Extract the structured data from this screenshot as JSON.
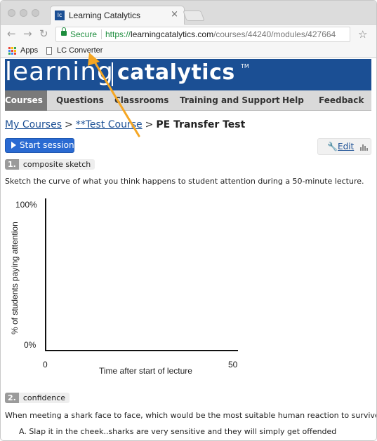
{
  "browser": {
    "tab_title": "Learning Catalytics",
    "tab_favicon_text": "lc",
    "tab_close": "×",
    "nav_back": "←",
    "nav_forward": "→",
    "nav_reload": "↻",
    "secure_label": "Secure",
    "url_scheme": "https://",
    "url_host": "learningcatalytics.com",
    "url_path": "/courses/44240/modules/427664",
    "star_icon": "☆"
  },
  "bookmarks": {
    "apps_label": "Apps",
    "lc_converter_label": "LC Converter",
    "apps_colors": [
      "#ea4335",
      "#fbbc05",
      "#34a853",
      "#4285f4",
      "#ea4335",
      "#fbbc05",
      "#34a853",
      "#4285f4",
      "#ea4335"
    ]
  },
  "site": {
    "logo_left": "learning",
    "logo_right": "catalytics",
    "logo_tm": "TM",
    "brand_color": "#1b4f94"
  },
  "nav": {
    "items": [
      {
        "label": "Courses",
        "active": true
      },
      {
        "label": "Questions",
        "active": false
      },
      {
        "label": "Classrooms",
        "active": false
      },
      {
        "label": "Training and Support",
        "active": false
      },
      {
        "label": "Help",
        "active": false
      },
      {
        "label": "Feedback",
        "active": false
      }
    ]
  },
  "breadcrumb": {
    "my_courses": "My Courses",
    "sep": ">",
    "course": "**Test Course",
    "current": "PE Transfer Test"
  },
  "actions": {
    "start_session": "Start session",
    "edit": "Edit"
  },
  "questions": [
    {
      "number": "1.",
      "title": "composite sketch",
      "prompt": "Sketch the curve of what you think happens to student attention during a 50-minute lecture."
    },
    {
      "number": "2.",
      "title": "confidence",
      "prompt": "When meeting a shark face to face, which would be the most suitable human reaction to survive:",
      "options": [
        "A. Slap it in the cheek..sharks are very sensitive and they will simply get offended"
      ]
    }
  ],
  "sketch": {
    "y_top_label": "100%",
    "y_bottom_label": "0%",
    "y_axis_title": "% of students paying attention",
    "x_left_label": "0",
    "x_right_label": "50",
    "x_axis_title": "Time after start of lecture"
  },
  "annotation": {
    "arrow_color": "#f5a623"
  }
}
